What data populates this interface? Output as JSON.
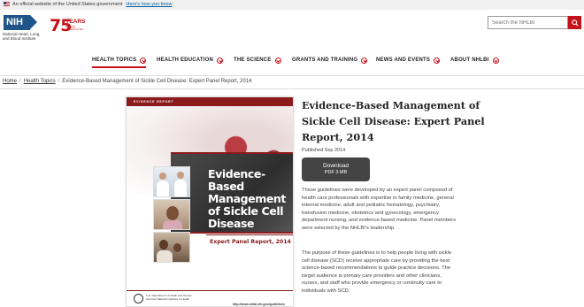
{
  "gov_banner": {
    "text": "An official website of the United States government",
    "link": "Here's how you know"
  },
  "header": {
    "nih_logo": "NIH",
    "nih_subtitle": "National Heart, Lung, and Blood Institute",
    "anniversary": {
      "number": "75",
      "word": "YEARS",
      "tagline": "Bringing research to life"
    },
    "search_placeholder": "Search the NHLBI"
  },
  "nav": {
    "items": [
      {
        "label": "HEALTH TOPICS",
        "active": true
      },
      {
        "label": "HEALTH EDUCATION",
        "active": false
      },
      {
        "label": "THE SCIENCE",
        "active": false
      },
      {
        "label": "GRANTS AND TRAINING",
        "active": false
      },
      {
        "label": "NEWS AND EVENTS",
        "active": false
      },
      {
        "label": "ABOUT NHLBI",
        "active": false
      }
    ]
  },
  "breadcrumb": {
    "home": "Home",
    "section": "Health Topics",
    "current": "Evidence-Based Management of Sickle Cell Disease: Expert Panel Report, 2014"
  },
  "cover": {
    "topbar": "EVIDENCE REPORT",
    "title": "Evidence-Based Management of Sickle Cell Disease",
    "subtitle": "Expert Panel Report, 2014",
    "org": "U.S. Department of Health and Human Services National Institutes of Health",
    "url": "http://www.nhlbi.nih.gov/guidelines"
  },
  "article": {
    "title": "Evidence-Based Management of Sickle Cell Disease: Expert Panel Report, 2014",
    "published": "Published Sep 2014",
    "download_label": "Download",
    "download_meta": "PDF 3 MB",
    "paragraph1": "These guidelines were developed by an expert panel composed of health care professionals with expertise in family medicine, general internal medicine, adult and pediatric hematology, psychiatry, transfusion medicine, obstetrics and gynecology, emergency department nursing, and evidence-based medicine. Panel members were selected by the NHLBI's leadership.",
    "paragraph2": "The purpose of these guidelines is to help people living with sickle cell disease (SCD) receive appropriate care by providing the best science-based recommendations to guide practice decisions. The target audience is primary care providers and other clinicians, nurses, and staff who provide emergency or continuity care to individuals with SCD."
  },
  "colors": {
    "brand_red": "#c4121a",
    "nih_blue": "#20558a",
    "button_dark": "#444444"
  }
}
